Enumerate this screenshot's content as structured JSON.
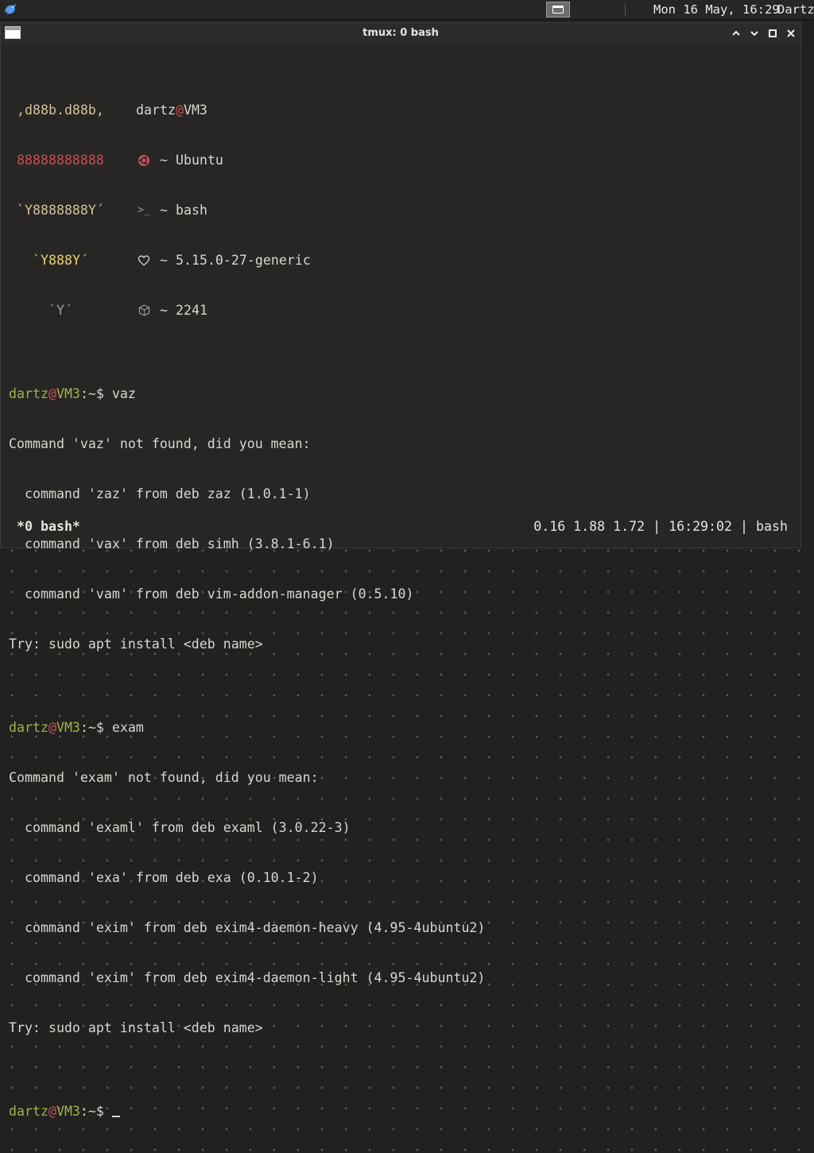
{
  "top_panel": {
    "clock": "Mon 16 May, 16:29",
    "user": "Dartz",
    "launcher_icon": "blue-bird-icon",
    "taskbar_window_icon": "window-icon"
  },
  "window": {
    "title": "tmux: 0 bash",
    "menu_icon": "window-menu-icon",
    "buttons": [
      "minimize-icon",
      "maximize-icon",
      "restore-icon",
      "close-icon"
    ]
  },
  "fetch": {
    "art": [
      ",d88b.d88b,",
      "88888888888",
      "`Y8888888Y´",
      "`Y888Y´",
      "`Y´"
    ],
    "user": "dartz",
    "at": "@",
    "host": "VM3",
    "rows": [
      {
        "icon": "ubuntu-logo-icon",
        "text": "~ Ubuntu"
      },
      {
        "icon": "terminal-prompt-icon",
        "text": "~ bash"
      },
      {
        "icon": "heart-icon",
        "text": "~ 5.15.0-27-generic"
      },
      {
        "icon": "package-icon",
        "text": "~ 2241"
      }
    ]
  },
  "prompt": {
    "user": "dartz",
    "at": "@",
    "host": "VM3",
    "suffix": ":~$"
  },
  "session": [
    {
      "cmd": "vaz",
      "output": [
        "Command 'vaz' not found, did you mean:",
        "  command 'zaz' from deb zaz (1.0.1-1)",
        "  command 'vax' from deb simh (3.8.1-6.1)",
        "  command 'vam' from deb vim-addon-manager (0.5.10)",
        "Try: sudo apt install <deb name>"
      ]
    },
    {
      "cmd": "exam",
      "output": [
        "Command 'exam' not found, did you mean:",
        "  command 'examl' from deb examl (3.0.22-3)",
        "  command 'exa' from deb exa (0.10.1-2)",
        "  command 'exim' from deb exim4-daemon-heavy (4.95-4ubuntu2)",
        "  command 'exim' from deb exim4-daemon-light (4.95-4ubuntu2)",
        "Try: sudo apt install <deb name>"
      ]
    }
  ],
  "tmux_status": {
    "window_label": "*0 bash*",
    "load": "0.16 1.88 1.72",
    "separator": "|",
    "time": "16:29:02",
    "session": "bash"
  },
  "colors": {
    "prompt_user": "#9fb34b",
    "prompt_host": "#9fb34b",
    "logo_red": "#c7505a",
    "logo_beige": "#d3c49a",
    "logo_yellow": "#e7cf72",
    "terminal_bg": "#282624",
    "terminal_fg": "#d9d6cf"
  }
}
